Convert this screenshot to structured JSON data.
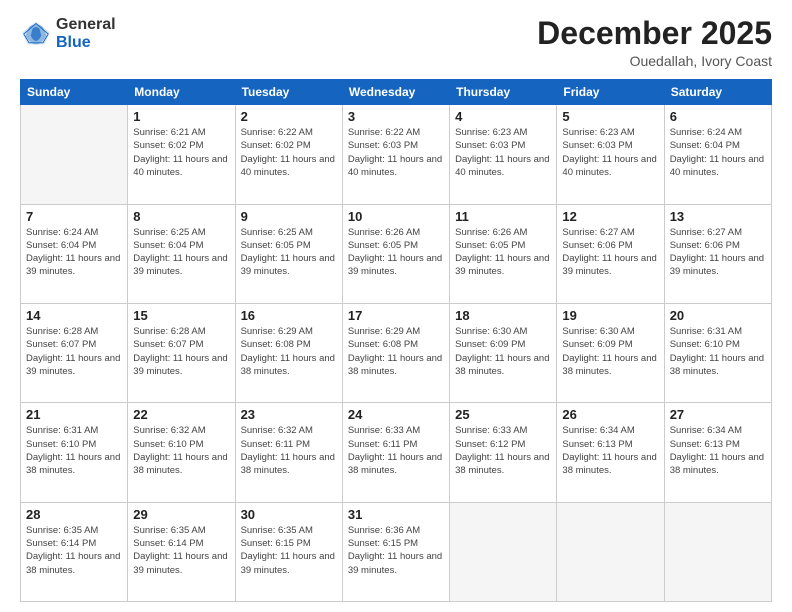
{
  "logo": {
    "general": "General",
    "blue": "Blue"
  },
  "header": {
    "title": "December 2025",
    "subtitle": "Ouedallah, Ivory Coast"
  },
  "weekdays": [
    "Sunday",
    "Monday",
    "Tuesday",
    "Wednesday",
    "Thursday",
    "Friday",
    "Saturday"
  ],
  "weeks": [
    [
      {
        "day": "",
        "empty": true
      },
      {
        "day": "1",
        "sunrise": "6:21 AM",
        "sunset": "6:02 PM",
        "daylight": "11 hours and 40 minutes."
      },
      {
        "day": "2",
        "sunrise": "6:22 AM",
        "sunset": "6:02 PM",
        "daylight": "11 hours and 40 minutes."
      },
      {
        "day": "3",
        "sunrise": "6:22 AM",
        "sunset": "6:03 PM",
        "daylight": "11 hours and 40 minutes."
      },
      {
        "day": "4",
        "sunrise": "6:23 AM",
        "sunset": "6:03 PM",
        "daylight": "11 hours and 40 minutes."
      },
      {
        "day": "5",
        "sunrise": "6:23 AM",
        "sunset": "6:03 PM",
        "daylight": "11 hours and 40 minutes."
      },
      {
        "day": "6",
        "sunrise": "6:24 AM",
        "sunset": "6:04 PM",
        "daylight": "11 hours and 40 minutes."
      }
    ],
    [
      {
        "day": "7",
        "sunrise": "6:24 AM",
        "sunset": "6:04 PM",
        "daylight": "11 hours and 39 minutes."
      },
      {
        "day": "8",
        "sunrise": "6:25 AM",
        "sunset": "6:04 PM",
        "daylight": "11 hours and 39 minutes."
      },
      {
        "day": "9",
        "sunrise": "6:25 AM",
        "sunset": "6:05 PM",
        "daylight": "11 hours and 39 minutes."
      },
      {
        "day": "10",
        "sunrise": "6:26 AM",
        "sunset": "6:05 PM",
        "daylight": "11 hours and 39 minutes."
      },
      {
        "day": "11",
        "sunrise": "6:26 AM",
        "sunset": "6:05 PM",
        "daylight": "11 hours and 39 minutes."
      },
      {
        "day": "12",
        "sunrise": "6:27 AM",
        "sunset": "6:06 PM",
        "daylight": "11 hours and 39 minutes."
      },
      {
        "day": "13",
        "sunrise": "6:27 AM",
        "sunset": "6:06 PM",
        "daylight": "11 hours and 39 minutes."
      }
    ],
    [
      {
        "day": "14",
        "sunrise": "6:28 AM",
        "sunset": "6:07 PM",
        "daylight": "11 hours and 39 minutes."
      },
      {
        "day": "15",
        "sunrise": "6:28 AM",
        "sunset": "6:07 PM",
        "daylight": "11 hours and 39 minutes."
      },
      {
        "day": "16",
        "sunrise": "6:29 AM",
        "sunset": "6:08 PM",
        "daylight": "11 hours and 38 minutes."
      },
      {
        "day": "17",
        "sunrise": "6:29 AM",
        "sunset": "6:08 PM",
        "daylight": "11 hours and 38 minutes."
      },
      {
        "day": "18",
        "sunrise": "6:30 AM",
        "sunset": "6:09 PM",
        "daylight": "11 hours and 38 minutes."
      },
      {
        "day": "19",
        "sunrise": "6:30 AM",
        "sunset": "6:09 PM",
        "daylight": "11 hours and 38 minutes."
      },
      {
        "day": "20",
        "sunrise": "6:31 AM",
        "sunset": "6:10 PM",
        "daylight": "11 hours and 38 minutes."
      }
    ],
    [
      {
        "day": "21",
        "sunrise": "6:31 AM",
        "sunset": "6:10 PM",
        "daylight": "11 hours and 38 minutes."
      },
      {
        "day": "22",
        "sunrise": "6:32 AM",
        "sunset": "6:10 PM",
        "daylight": "11 hours and 38 minutes."
      },
      {
        "day": "23",
        "sunrise": "6:32 AM",
        "sunset": "6:11 PM",
        "daylight": "11 hours and 38 minutes."
      },
      {
        "day": "24",
        "sunrise": "6:33 AM",
        "sunset": "6:11 PM",
        "daylight": "11 hours and 38 minutes."
      },
      {
        "day": "25",
        "sunrise": "6:33 AM",
        "sunset": "6:12 PM",
        "daylight": "11 hours and 38 minutes."
      },
      {
        "day": "26",
        "sunrise": "6:34 AM",
        "sunset": "6:13 PM",
        "daylight": "11 hours and 38 minutes."
      },
      {
        "day": "27",
        "sunrise": "6:34 AM",
        "sunset": "6:13 PM",
        "daylight": "11 hours and 38 minutes."
      }
    ],
    [
      {
        "day": "28",
        "sunrise": "6:35 AM",
        "sunset": "6:14 PM",
        "daylight": "11 hours and 38 minutes."
      },
      {
        "day": "29",
        "sunrise": "6:35 AM",
        "sunset": "6:14 PM",
        "daylight": "11 hours and 39 minutes."
      },
      {
        "day": "30",
        "sunrise": "6:35 AM",
        "sunset": "6:15 PM",
        "daylight": "11 hours and 39 minutes."
      },
      {
        "day": "31",
        "sunrise": "6:36 AM",
        "sunset": "6:15 PM",
        "daylight": "11 hours and 39 minutes."
      },
      {
        "day": "",
        "empty": true
      },
      {
        "day": "",
        "empty": true
      },
      {
        "day": "",
        "empty": true
      }
    ]
  ]
}
